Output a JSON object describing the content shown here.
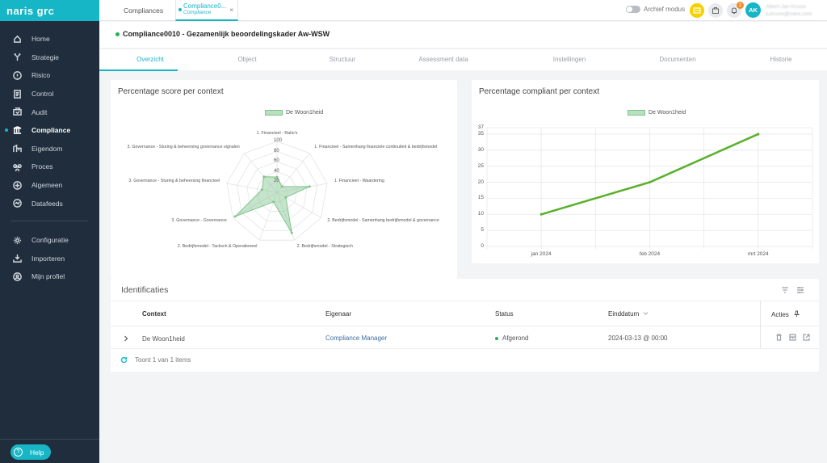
{
  "app": {
    "logo": "naris grc"
  },
  "sidebar": {
    "items": [
      {
        "label": "Home",
        "icon": "home-icon"
      },
      {
        "label": "Strategie",
        "icon": "strategy-icon"
      },
      {
        "label": "Risico",
        "icon": "risk-icon"
      },
      {
        "label": "Control",
        "icon": "control-icon"
      },
      {
        "label": "Audit",
        "icon": "audit-icon"
      },
      {
        "label": "Compliance",
        "icon": "compliance-icon",
        "active": true
      },
      {
        "label": "Eigendom",
        "icon": "ownership-icon"
      },
      {
        "label": "Proces",
        "icon": "process-icon"
      },
      {
        "label": "Algemeen",
        "icon": "general-icon"
      },
      {
        "label": "Datafeeds",
        "icon": "datafeeds-icon"
      }
    ],
    "bottom_items": [
      {
        "label": "Configuratie",
        "icon": "gear-icon"
      },
      {
        "label": "Importeren",
        "icon": "import-icon"
      },
      {
        "label": "Mijn profiel",
        "icon": "profile-icon"
      }
    ],
    "help_label": "Help"
  },
  "topbar": {
    "tab_compliances": "Compliances",
    "active_tab_title": "Compliance0...",
    "active_tab_subtitle": "Compliance",
    "close_glyph": "×",
    "archief_label": "Archief modus",
    "notification_count": "2",
    "avatar_initials": "AK",
    "user_name": "Albert-Jan Kruize",
    "user_email": "a.kruize@naris.com"
  },
  "page": {
    "title": "Compliance0010 - Gezamenlijk beoordelingskader Aw-WSW"
  },
  "tabs": [
    "Overzicht",
    "Object",
    "Structuur",
    "Assessment data",
    "Instellingen",
    "Documenten",
    "Historie"
  ],
  "radar_card": {
    "title": "Percentage score per context"
  },
  "line_card": {
    "title": "Percentage compliant per context"
  },
  "chart_data": [
    {
      "type": "radar",
      "title": "Percentage score per context",
      "legend": [
        "De Woon1heid"
      ],
      "axes": [
        "1. Financieel - Ratio's",
        "1. Financieel - Samenhang financiele continuiteit & bedrijfsmodel",
        "1. Financieel - Waardering",
        "2. Bedrijfsmodel - Samenhang bedrijfsmodel & governance",
        "2. Bedrijfsmodel - Strategisch",
        "2. Bedrijfsmodel - Tactisch & Operationeel",
        "3. Governance - Governance",
        "3. Governance - Sturing & beheersing financieel",
        "3. Governance - Sturing & beheersing governance signalen"
      ],
      "ticks": [
        "20",
        "40",
        "60",
        "80",
        "100"
      ],
      "r_range": [
        0,
        100
      ],
      "series": [
        {
          "name": "De Woon1heid",
          "values": [
            30,
            15,
            65,
            20,
            85,
            20,
            95,
            30,
            40
          ]
        }
      ],
      "color": "#7fc48b"
    },
    {
      "type": "line",
      "title": "Percentage compliant per context",
      "legend": [
        "De Woon1heid"
      ],
      "categories": [
        "jan 2024",
        "feb 2024",
        "mrt 2024"
      ],
      "y_ticks": [
        "0",
        "5",
        "10",
        "15",
        "20",
        "25",
        "30",
        "35",
        "37"
      ],
      "ylim": [
        0,
        37
      ],
      "series": [
        {
          "name": "De Woon1heid",
          "values": [
            10,
            20,
            35
          ]
        }
      ],
      "color": "#5ab02c",
      "grid": true
    }
  ],
  "identificaties": {
    "title": "Identificaties",
    "headers": {
      "context": "Context",
      "eigenaar": "Eigenaar",
      "status": "Status",
      "einddatum": "Einddatum",
      "acties": "Acties"
    },
    "rows": [
      {
        "context": "De Woon1heid",
        "eigenaar": "Compliance Manager",
        "status": "Afgerond",
        "einddatum": "2024-03-13 @ 00:00"
      }
    ],
    "footer": "Toont 1 van 1 items"
  }
}
